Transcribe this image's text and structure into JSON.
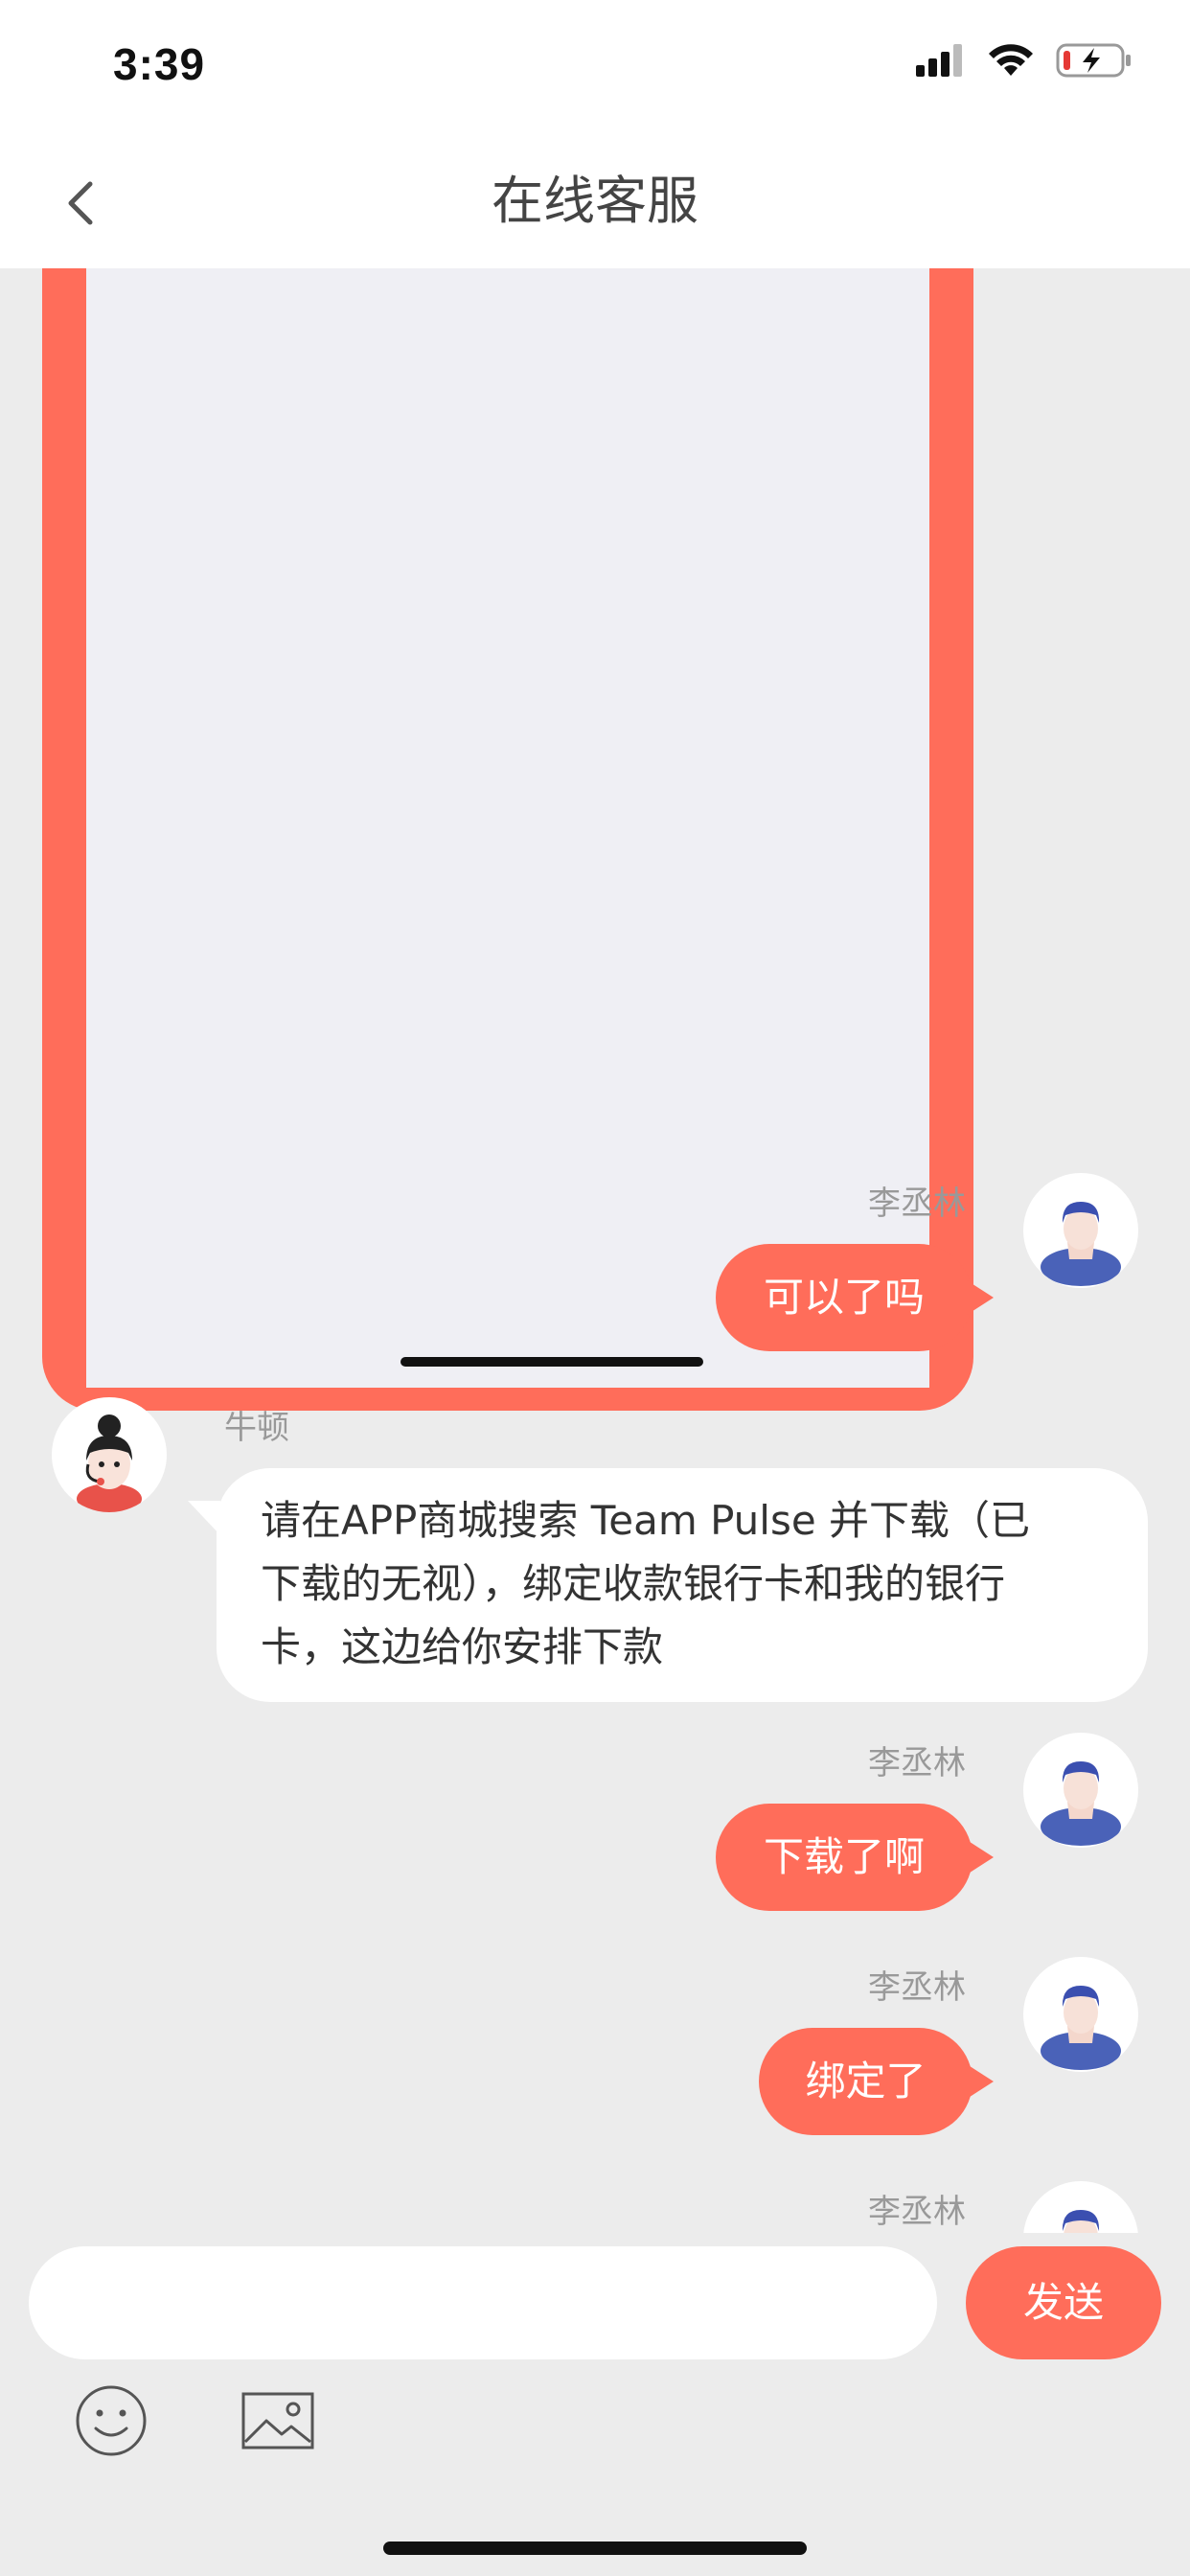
{
  "status_bar": {
    "time": "3:39"
  },
  "nav": {
    "title": "在线客服"
  },
  "messages": [
    {
      "type": "image",
      "direction": "out"
    },
    {
      "direction": "out",
      "sender": "李丞林",
      "text": "可以了吗"
    },
    {
      "direction": "in",
      "sender": "牛顿",
      "lines": [
        "请在APP商城搜索 Team Pulse 并下载（已",
        "下载的无视），绑定收款银行卡和我的银行",
        "卡，这边给你安排下款"
      ]
    },
    {
      "direction": "out",
      "sender": "李丞林",
      "text": "下载了啊"
    },
    {
      "direction": "out",
      "sender": "李丞林",
      "text": "绑定了"
    },
    {
      "direction": "out",
      "sender": "李丞林",
      "text": ""
    }
  ],
  "input": {
    "placeholder": "",
    "send_label": "发送"
  },
  "toolbar": {
    "emoji_icon": "smiley-icon",
    "image_icon": "picture-icon"
  },
  "colors": {
    "accent": "#ff6d5a",
    "background": "#ececec"
  }
}
